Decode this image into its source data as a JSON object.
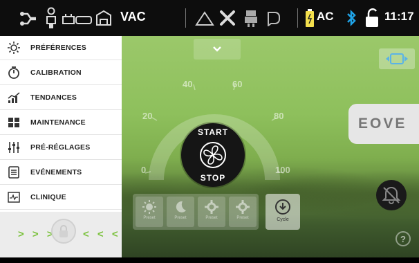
{
  "status_bar": {
    "mode": "VAC",
    "power_source": "AC",
    "time": "11:17",
    "icons": [
      "circuit-icon",
      "patient-icon",
      "ventilator-setup-icon",
      "building-icon",
      "warning-triangle-icon",
      "tools-icon",
      "patient-device-icon",
      "mask-icon",
      "battery-icon",
      "bluetooth-icon",
      "unlocked-icon"
    ]
  },
  "sidebar": {
    "items": [
      {
        "label": "PRÉFÉRENCES",
        "icon": "sun-icon"
      },
      {
        "label": "CALIBRATION",
        "icon": "calibration-icon"
      },
      {
        "label": "TENDANCES",
        "icon": "trends-icon"
      },
      {
        "label": "MAINTENANCE",
        "icon": "maintenance-icon"
      },
      {
        "label": "PRÉ-RÉGLAGES",
        "icon": "sliders-icon"
      },
      {
        "label": "EVÉNEMENTS",
        "icon": "events-icon"
      },
      {
        "label": "CLINIQUE",
        "icon": "waveform-icon"
      }
    ],
    "lock": {
      "left_chevrons": "> > >",
      "right_chevrons": "< < <",
      "icon": "lock-icon"
    }
  },
  "main": {
    "dropdown_icon": "chevron-down-icon",
    "scale_labels": [
      "0",
      "20",
      "40",
      "60",
      "80",
      "100"
    ],
    "start_label": "START",
    "stop_label": "STOP",
    "fan_icon": "fan-icon",
    "presets": [
      {
        "icon": "sun-icon",
        "label": "Preset"
      },
      {
        "icon": "moon-icon",
        "label": "Preset"
      },
      {
        "icon": "gear-icon",
        "label": "Preset"
      },
      {
        "icon": "gear-icon",
        "label": "Preset"
      }
    ],
    "cycle": {
      "label": "Cycle",
      "icon": "cycle-icon"
    },
    "logo_text": "EOVE",
    "screen_icon": "screen-expand-icon",
    "alarm_icon": "alarm-bell-icon",
    "help_symbol": "?"
  },
  "colors": {
    "accent_green": "#79c13a",
    "bluetooth": "#1fa2e6",
    "battery": "#f4e04d",
    "status_bar_bg": "#0d0d0d"
  }
}
